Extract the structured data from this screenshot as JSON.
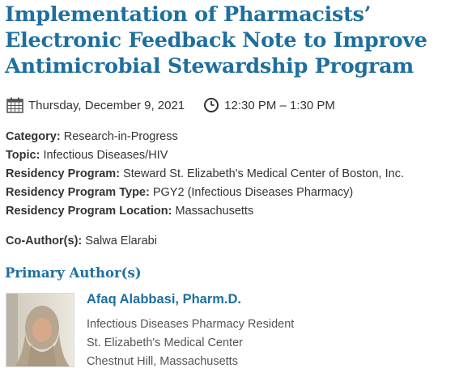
{
  "event": {
    "title": "Implementation of Pharmacists’ Electronic Feedback Note to Improve Antimicrobial Stewardship Program",
    "date": "Thursday, December 9, 2021",
    "time": "12:30 PM – 1:30 PM",
    "date_icon": "calendar-icon",
    "time_icon": "clock-icon"
  },
  "details": [
    {
      "label": "Category:",
      "value": "Research-in-Progress"
    },
    {
      "label": "Topic:",
      "value": "Infectious Diseases/HIV"
    },
    {
      "label": "Residency Program:",
      "value": "Steward St. Elizabeth's Medical Center of Boston, Inc."
    },
    {
      "label": "Residency Program Type:",
      "value": "PGY2 (Infectious Diseases Pharmacy)"
    },
    {
      "label": "Residency Program Location:",
      "value": "Massachusetts"
    }
  ],
  "coauthor": {
    "label": "Co-Author(s):",
    "value": "Salwa Elarabi"
  },
  "primary_author": {
    "heading": "Primary Author(s)",
    "name": "Afaq Alabbasi, Pharm.D.",
    "role": "Infectious Diseases Pharmacy Resident",
    "organization": "St. Elizabeth's Medical Center",
    "location": "Chestnut Hill, Massachusetts"
  },
  "colors": {
    "accent": "#1f6f9e",
    "text": "#333333",
    "muted": "#555555"
  }
}
